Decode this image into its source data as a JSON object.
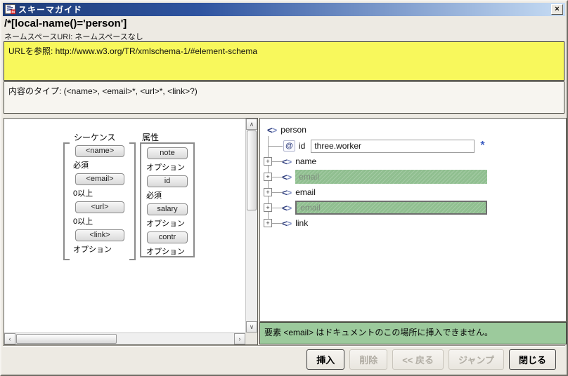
{
  "titlebar": {
    "title": "スキーマガイド",
    "close_icon": "×"
  },
  "header": {
    "xpath": "/*[local-name()='person']",
    "namespace": "ネームスペースURI: ネームスペースなし"
  },
  "url_box": {
    "text": "URLを参照: http://www.w3.org/TR/xmlschema-1/#element-schema"
  },
  "type_box": {
    "text": "内容のタイプ:  (<name>, <email>*, <url>*, <link>?)"
  },
  "schema": {
    "sequence_label": "シーケンス",
    "sequence_items": [
      {
        "name": "<name>",
        "occurrence": "必須"
      },
      {
        "name": "<email>",
        "occurrence": "0以上"
      },
      {
        "name": "<url>",
        "occurrence": "0以上"
      },
      {
        "name": "<link>",
        "occurrence": "オプション"
      }
    ],
    "attributes_label": "属性",
    "attribute_items": [
      {
        "name": "note",
        "occurrence": "オプション"
      },
      {
        "name": "id",
        "occurrence": "必須"
      },
      {
        "name": "salary",
        "occurrence": "オプション"
      },
      {
        "name": "contr",
        "occurrence": "オプション"
      }
    ]
  },
  "tree": {
    "root": "person",
    "attribute": {
      "name": "id",
      "value": "three.worker",
      "required_marker": "*"
    },
    "children": [
      {
        "label": "name"
      },
      {
        "label": "email"
      },
      {
        "label": "email"
      },
      {
        "label": "email"
      },
      {
        "label": "link"
      }
    ]
  },
  "message": {
    "text": "要素 <email> はドキュメントのこの場所に挿入できません。"
  },
  "buttons": {
    "insert": "挿入",
    "delete": "削除",
    "back": "<< 戻る",
    "jump": "ジャンプ",
    "close": "閉じる"
  },
  "icons": {
    "element_open": "<",
    "element_close": ">",
    "attribute_at": "@",
    "expand": "+",
    "scroll_up": "∧",
    "scroll_down": "∨",
    "scroll_left": "‹",
    "scroll_right": "›"
  }
}
